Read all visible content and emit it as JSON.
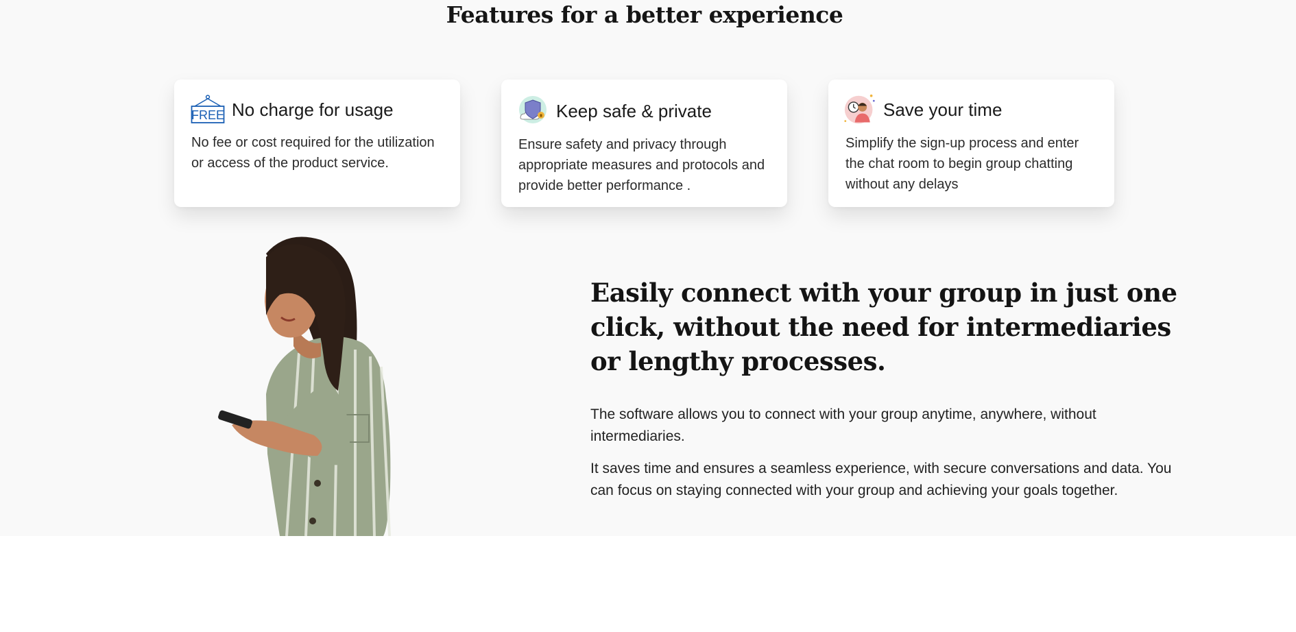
{
  "features": {
    "title": "Features for a better experience",
    "cards": [
      {
        "icon": "free-sign-icon",
        "title": "No charge for usage",
        "description": "No fee or cost required for the utilization or access of the product service."
      },
      {
        "icon": "shield-cloud-icon",
        "title": "Keep safe & private",
        "description": "Ensure safety and privacy through appropriate measures and protocols and provide better performance ."
      },
      {
        "icon": "person-clock-icon",
        "title": "Save your time",
        "description": "Simplify the sign-up process and enter the chat room to begin group chatting without any delays"
      }
    ]
  },
  "connect": {
    "headline": "Easily connect with your group in just one click, without the need for intermediaries or lengthy processes.",
    "paragraphs": [
      "The software allows you to connect with your group anytime, anywhere, without intermediaries.",
      "It saves time and ensures a seamless experience, with secure conversations and data. You can focus on staying connected with your group and achieving your goals together."
    ],
    "image": "woman-using-phone"
  },
  "colors": {
    "section_bg": "#f9f9f9",
    "card_bg": "#ffffff",
    "free_icon_blue": "#1a5fb4"
  }
}
